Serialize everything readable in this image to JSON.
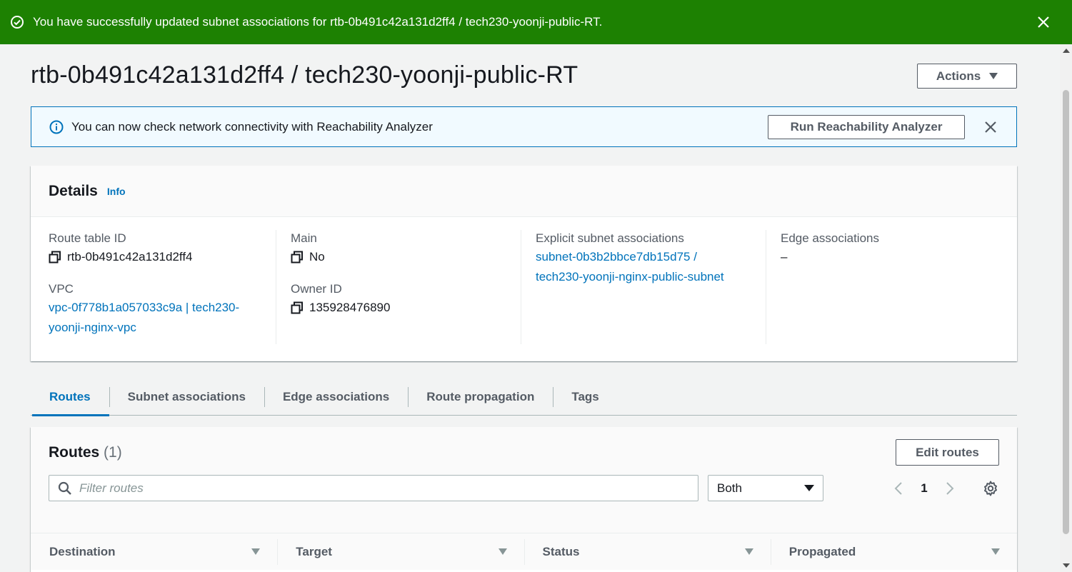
{
  "flash": {
    "message": "You have successfully updated subnet associations for rtb-0b491c42a131d2ff4 / tech230-yoonji-public-RT."
  },
  "page": {
    "title": "rtb-0b491c42a131d2ff4 / tech230-yoonji-public-RT",
    "actions_label": "Actions"
  },
  "info_banner": {
    "message": "You can now check network connectivity with Reachability Analyzer",
    "button_label": "Run Reachability Analyzer"
  },
  "details": {
    "title": "Details",
    "info_link": "Info",
    "route_table_id_label": "Route table ID",
    "route_table_id": "rtb-0b491c42a131d2ff4",
    "vpc_label": "VPC",
    "vpc_line1": "vpc-0f778b1a057033c9a | tech230-",
    "vpc_line2": "yoonji-nginx-vpc",
    "main_label": "Main",
    "main_value": "No",
    "owner_id_label": "Owner ID",
    "owner_id": "135928476890",
    "explicit_label": "Explicit subnet associations",
    "explicit_line1": "subnet-0b3b2bbce7db15d75 /",
    "explicit_line2": "tech230-yoonji-nginx-public-subnet",
    "edge_label": "Edge associations",
    "edge_value": "–"
  },
  "tabs": [
    {
      "label": "Routes",
      "active": true
    },
    {
      "label": "Subnet associations",
      "active": false
    },
    {
      "label": "Edge associations",
      "active": false
    },
    {
      "label": "Route propagation",
      "active": false
    },
    {
      "label": "Tags",
      "active": false
    }
  ],
  "routes": {
    "title": "Routes",
    "count": "(1)",
    "edit_label": "Edit routes",
    "filter_placeholder": "Filter routes",
    "select_value": "Both",
    "page_number": "1",
    "columns": [
      "Destination",
      "Target",
      "Status",
      "Propagated"
    ]
  },
  "colors": {
    "success": "#1d8102",
    "link": "#0073bb",
    "info_bg": "#f1faff"
  }
}
